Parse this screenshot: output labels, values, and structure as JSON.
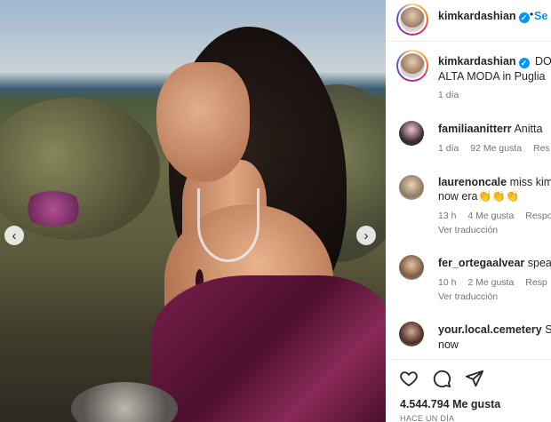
{
  "post": {
    "account": "kimkardashian",
    "follow_label": "Se",
    "caption_line1": "DOL",
    "caption_line2": "ALTA MODA in Puglia",
    "caption_age": "1 día"
  },
  "comments": [
    {
      "user": "familiaanitterr",
      "text": "Anitta",
      "text2": "",
      "age": "1 día",
      "likes": "92 Me gusta",
      "reply": "Res",
      "translation": ""
    },
    {
      "user": "laurenoncale",
      "text": "miss kim",
      "text2": "now era👏👏👏",
      "age": "13 h",
      "likes": "4 Me gusta",
      "reply": "Respo",
      "translation": "Ver traducción"
    },
    {
      "user": "fer_ortegaalvear",
      "text": "spea",
      "text2": "",
      "age": "10 h",
      "likes": "2 Me gusta",
      "reply": "Resp",
      "translation": "Ver traducción"
    },
    {
      "user": "your.local.cemetery",
      "text": "Sl",
      "text2": "now",
      "age": "",
      "likes": "",
      "reply": "",
      "translation": ""
    }
  ],
  "footer": {
    "likes": "4.544.794 Me gusta",
    "time": "HACE UN DÍA"
  },
  "icons": {
    "like": "heart-icon",
    "comment": "comment-icon",
    "share": "share-icon",
    "prev": "chevron-left-icon",
    "next": "chevron-right-icon",
    "verified": "verified-badge-icon"
  },
  "colors": {
    "accent": "#0095f6",
    "muted": "#737373"
  }
}
